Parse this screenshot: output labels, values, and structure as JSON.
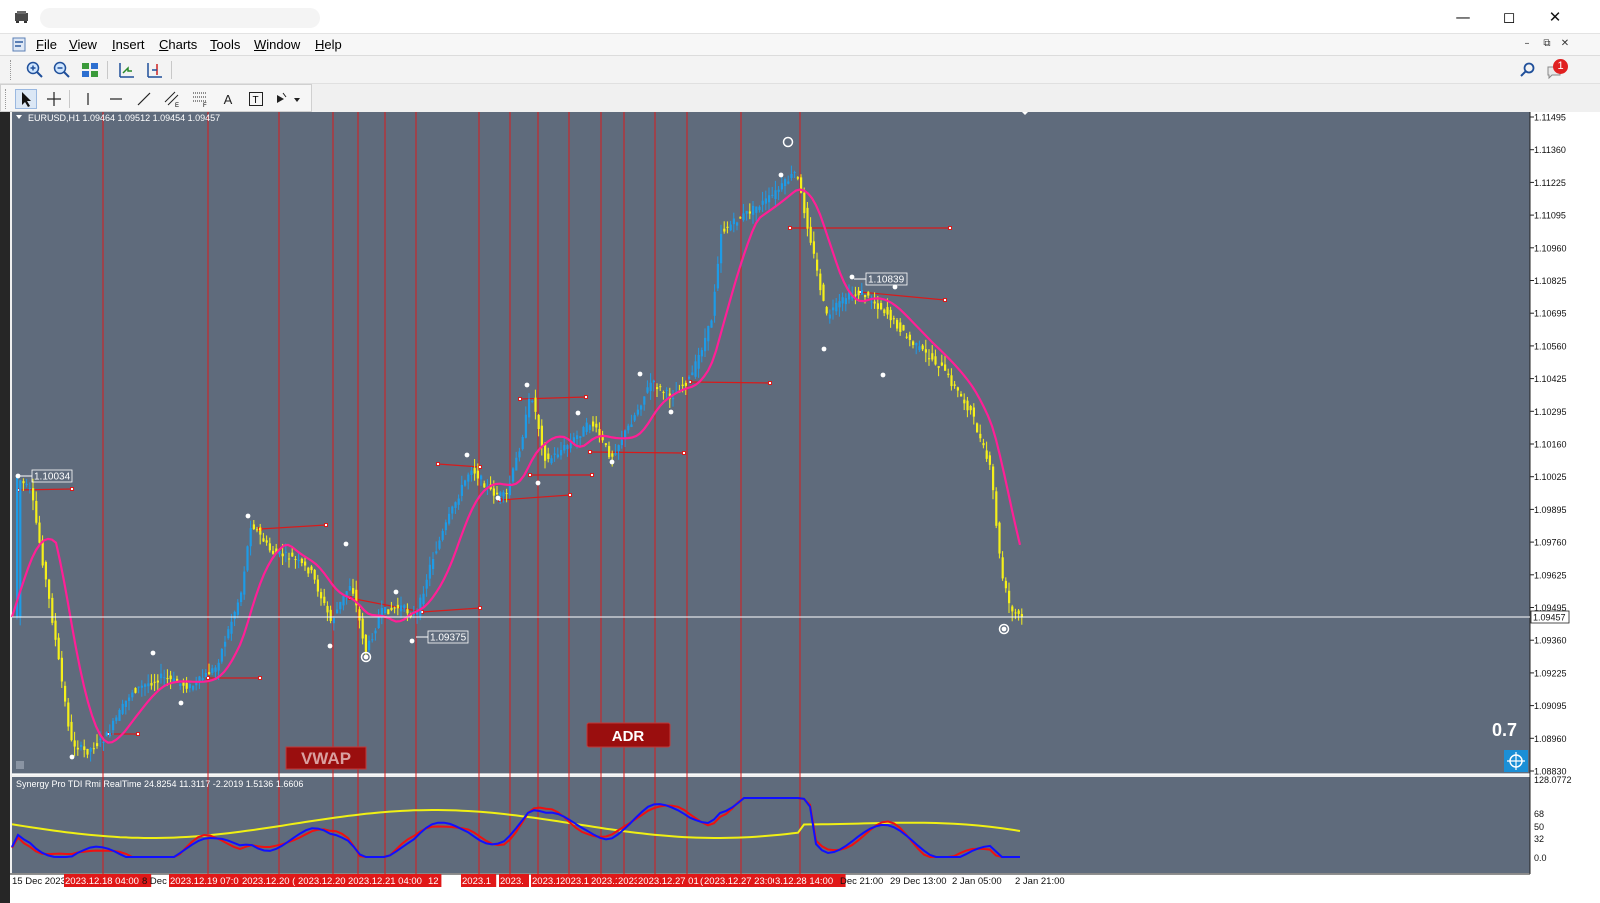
{
  "window": {
    "minimize_icon": "minimize-icon",
    "maximize_icon": "maximize-icon",
    "close_icon": "close-icon"
  },
  "menu": {
    "items": [
      {
        "label": "File",
        "accel": "F"
      },
      {
        "label": "View",
        "accel": "V"
      },
      {
        "label": "Insert",
        "accel": "I"
      },
      {
        "label": "Charts",
        "accel": "C"
      },
      {
        "label": "Tools",
        "accel": "T"
      },
      {
        "label": "Window",
        "accel": "W"
      },
      {
        "label": "Help",
        "accel": "H"
      }
    ]
  },
  "notifications": {
    "count": "1"
  },
  "chart": {
    "header": "EURUSD,H1  1.09464 1.09512 1.09454 1.09457",
    "current_price": "1.09457",
    "price_labels": [
      "1.11495",
      "1.11360",
      "1.11225",
      "1.11095",
      "1.10960",
      "1.10825",
      "1.10695",
      "1.10560",
      "1.10425",
      "1.10295",
      "1.10160",
      "1.10025",
      "1.09895",
      "1.09760",
      "1.09625",
      "1.09495",
      "1.09360",
      "1.09225",
      "1.09095",
      "1.08960",
      "1.08830"
    ],
    "level_labels": [
      {
        "text": "1.10034"
      },
      {
        "text": "1.09375"
      },
      {
        "text": "1.10839"
      }
    ],
    "vwap_label": "VWAP",
    "adr_label": "ADR",
    "adr_value": "0.7",
    "colors": {
      "background": "#5f6b7c",
      "bull": "#1e9be6",
      "bear": "#f5f01a",
      "ma": "#ff1f96",
      "session_line": "#d81b1b",
      "badge": "#9a0e0e"
    }
  },
  "indicator": {
    "header": "Synergy Pro TDI Rmi RealTime 24.8254 11.3117 -2.2019 1.5136 1.6606",
    "scale_labels": [
      "128.0772",
      "68",
      "50",
      "32",
      "0.0"
    ],
    "series_colors": {
      "fast": "#1010ff",
      "signal": "#ee1111",
      "base": "#f0f014"
    }
  },
  "time_axis": {
    "labels": [
      "15 Dec 2023",
      "2023.12.18 04:00",
      "8 Dec",
      "2023.12.19 07:0",
      "2023.12.20 (",
      "2023.12.20",
      "2023.12.21 04:00",
      "12",
      "2023.1",
      "2023.",
      "2023.1",
      "2023.1",
      "2023.1",
      "2023.1",
      "2023.12.27 01:00",
      "(",
      "2023.12.27 23:00",
      "3.12.28 14:00",
      "Dec 21:00",
      "29 Dec 13:00",
      "2 Jan 05:00",
      "2 Jan 21:00"
    ]
  }
}
